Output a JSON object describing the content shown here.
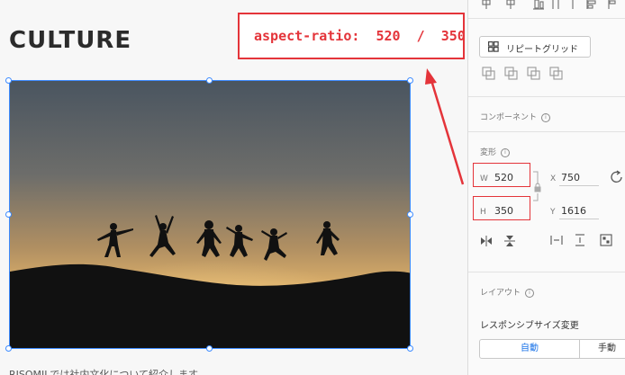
{
  "canvas": {
    "title": "CULTURE",
    "callout_text": "aspect-ratio:  520  /  350;",
    "caption": "RISOMILでは社内文化について紹介します。"
  },
  "panel": {
    "repeat_grid_label": "リピートグリッド",
    "component_title": "コンポーネント",
    "transform_title": "変形",
    "w_label": "W",
    "w_value": "520",
    "h_label": "H",
    "h_value": "350",
    "x_label": "X",
    "x_value": "750",
    "y_label": "Y",
    "y_value": "1616",
    "layout_title": "レイアウト",
    "responsive_label": "レスポンシブサイズ変更",
    "seg_auto": "自動",
    "seg_manual": "手動"
  },
  "colors": {
    "accent_red": "#e4343a",
    "selection_blue": "#3d8bff"
  }
}
